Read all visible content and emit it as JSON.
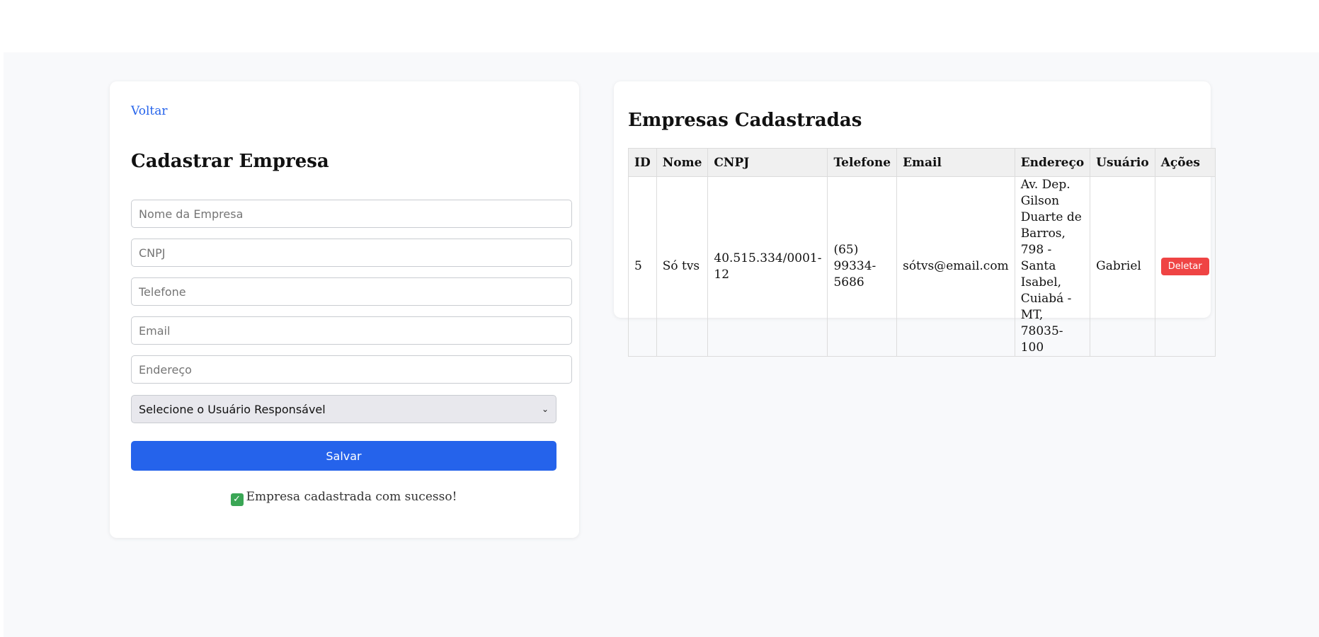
{
  "form": {
    "back_label": "Voltar",
    "title": "Cadastrar Empresa",
    "fields": {
      "nome": "Nome da Empresa",
      "cnpj": "CNPJ",
      "telefone": "Telefone",
      "email": "Email",
      "endereco": "Endereço"
    },
    "select_value": "Selecione o Usuário Responsável",
    "save_label": "Salvar",
    "success_message": "Empresa cadastrada com sucesso!"
  },
  "list": {
    "title": "Empresas Cadastradas",
    "headers": [
      "ID",
      "Nome",
      "CNPJ",
      "Telefone",
      "Email",
      "Endereço",
      "Usuário",
      "Ações"
    ],
    "rows": [
      {
        "id": "5",
        "nome": "Só tvs",
        "cnpj": "40.515.334/0001-12",
        "telefone": "(65) 99334-5686",
        "email": "sótvs@email.com",
        "endereco": "Av. Dep. Gilson Duarte de Barros, 798 - Santa Isabel, Cuiabá - MT, 78035-100",
        "usuario": "Gabriel",
        "delete_label": "Deletar"
      }
    ]
  },
  "colors": {
    "accent": "#2563eb",
    "danger": "#ef4444",
    "success": "#3aa655"
  }
}
